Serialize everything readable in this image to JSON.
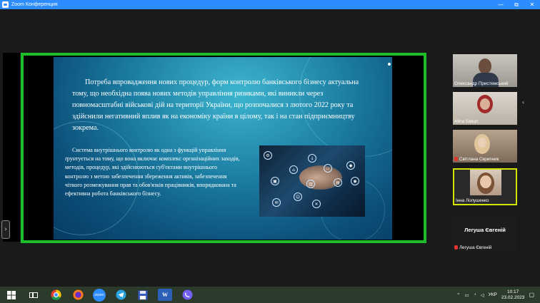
{
  "window": {
    "title": "Zoom Конференция",
    "minimize": "—",
    "maximize": "⧉",
    "close": "✕"
  },
  "slide": {
    "paragraph1": "Потреба впровадження нових процедур, форм контролю банківського бізнесу актуальна тому, що необхідна поява нових методів управління ризиками, які виникли через повномасштабні військові дій на території України, що розпочалися з лютого 2022 року та здійснили негативний вплив як на економіку країни в цілому, так і на стан підприємництву зокрема.",
    "paragraph2": "Система внутрішнього контролю як одна з функцій управління ґрунтується на тому, що вона включає комплекс організаційних заходів, методів, процедур, які здійснюються суб'єктами внутрішнього контролю з метою забезпечення збереження активів, забезпечення чіткого розмежування прав та обов'язків працівників, впорядкована та ефективна робота банківського бізнесу."
  },
  "participants": [
    {
      "name": "Олександр Пристемський",
      "muted": false
    },
    {
      "name": "Alina Sakun",
      "muted": false
    },
    {
      "name": "Світлана Скрипник",
      "muted": true
    },
    {
      "name": "Інна Лопушенко",
      "muted": false,
      "active_speaker": true
    },
    {
      "name": "Легуша Євгеній",
      "display_name": "Легуша Євгеній",
      "muted": true
    }
  ],
  "controls": {
    "collapse_left": "›",
    "collapse_right": "‹"
  },
  "taskbar": {
    "zoom_label": "zoom",
    "word_label": "W",
    "language": "УКР",
    "time": "10:17",
    "date": "23.02.2023"
  },
  "colors": {
    "titlebar": "#2d8cff",
    "share_border": "#1ebd2a",
    "active_speaker_border": "#d4e600",
    "taskbar": "#2b3a2a"
  }
}
